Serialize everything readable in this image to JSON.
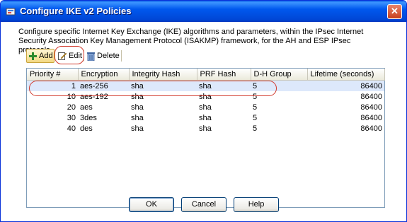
{
  "window": {
    "title": "Configure IKE v2 Policies",
    "close_glyph": "✕"
  },
  "description": "Configure specific Internet Key Exchange (IKE) algorithms and parameters, within the IPsec Internet Security Association Key Management Protocol (ISAKMP) framework, for the AH and ESP IPsec protocols.",
  "toolbar": {
    "add_label": "Add",
    "add_icon": "add-icon",
    "edit_label": "Edit",
    "edit_icon": "edit-icon",
    "delete_label": "Delete",
    "delete_icon": "trash-icon"
  },
  "table": {
    "columns": [
      "Priority #",
      "Encryption",
      "Integrity Hash",
      "PRF Hash",
      "D-H Group",
      "Lifetime (seconds)"
    ],
    "rows": [
      [
        "1",
        "aes-256",
        "sha",
        "sha",
        "5",
        "86400"
      ],
      [
        "10",
        "aes-192",
        "sha",
        "sha",
        "5",
        "86400"
      ],
      [
        "20",
        "aes",
        "sha",
        "sha",
        "5",
        "86400"
      ],
      [
        "30",
        "3des",
        "sha",
        "sha",
        "5",
        "86400"
      ],
      [
        "40",
        "des",
        "sha",
        "sha",
        "5",
        "86400"
      ]
    ],
    "selected_row": 0
  },
  "buttons": {
    "ok_label": "OK",
    "cancel_label": "Cancel",
    "help_label": "Help"
  },
  "colors": {
    "titlebar": "#0058ee",
    "highlight_ring": "#d23b2e",
    "selected_row": "#dde8fb"
  }
}
